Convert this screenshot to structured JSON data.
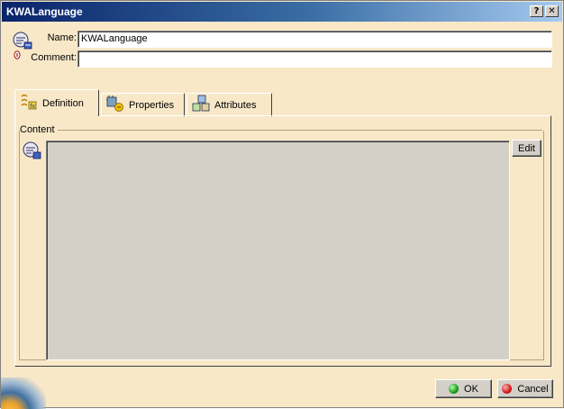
{
  "window": {
    "title": "KWALanguage",
    "help_label": "?",
    "close_label": "✕"
  },
  "header": {
    "name_label": "Name:",
    "name_value": "KWALanguage",
    "comment_label": "Comment:",
    "comment_value": ""
  },
  "tabs": [
    {
      "label": "Definition",
      "icon": "definition-icon",
      "active": true
    },
    {
      "label": "Properties",
      "icon": "properties-icon",
      "active": false
    },
    {
      "label": "Attributes",
      "icon": "attributes-icon",
      "active": false
    }
  ],
  "content": {
    "group_title": "Content",
    "edit_label": "Edit",
    "text": ""
  },
  "footer": {
    "ok_label": "OK",
    "cancel_label": "Cancel"
  },
  "colors": {
    "background": "#f8e8c8",
    "titlebar_start": "#0a246a",
    "titlebar_end": "#a6caf0",
    "content_area": "#d4d0c8",
    "ok_dot": "#1a9a1a",
    "cancel_dot": "#d01a1a"
  }
}
